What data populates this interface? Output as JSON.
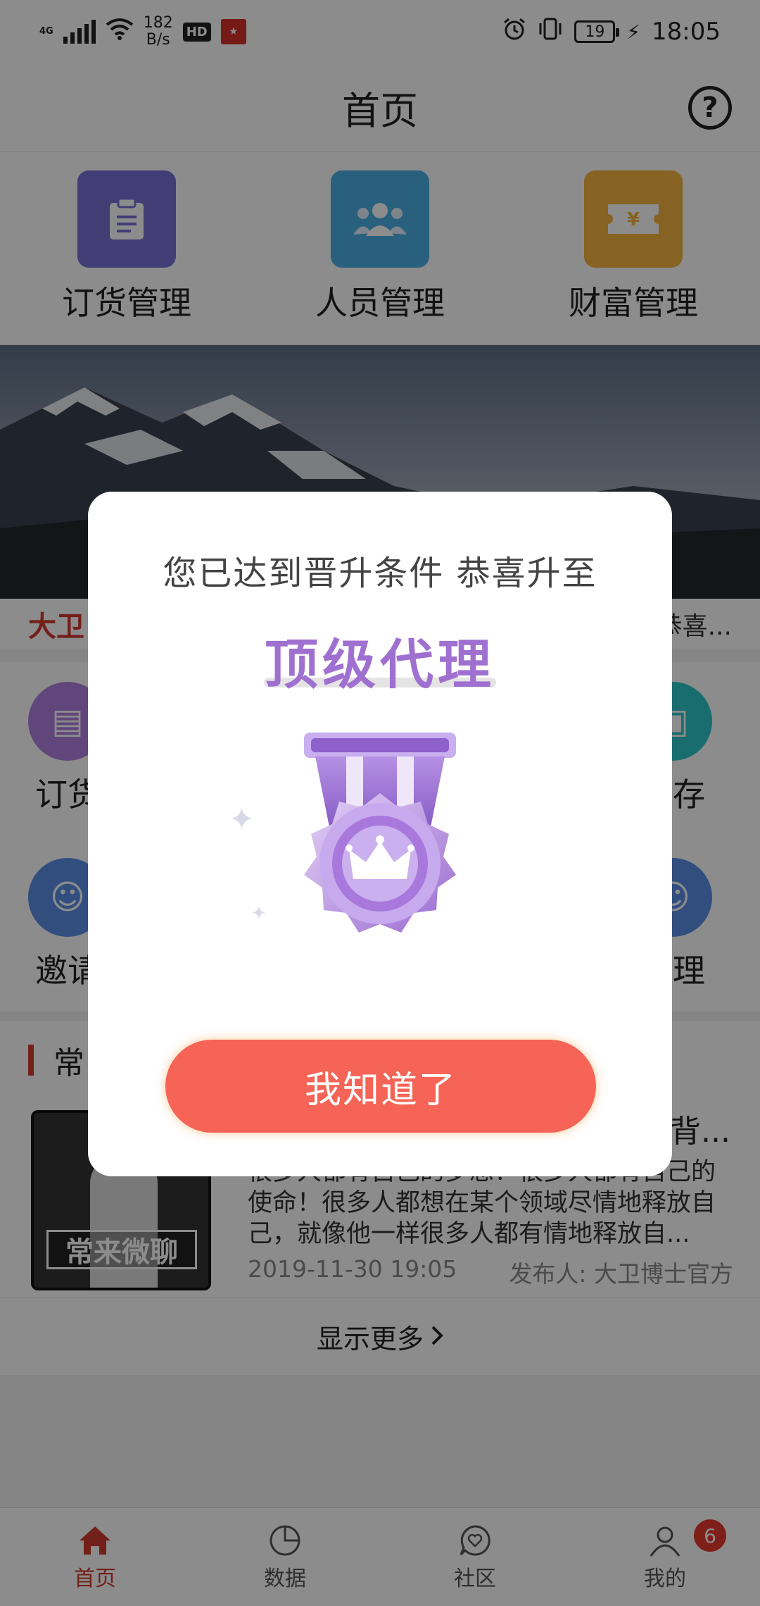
{
  "status_bar": {
    "network": "4G",
    "speed_value": "182",
    "speed_unit": "B/s",
    "hd": "HD",
    "battery": "19",
    "time": "18:05"
  },
  "header": {
    "title": "首页",
    "help": "?"
  },
  "quick_menu": [
    {
      "label": "订货管理",
      "icon": "clipboard-icon",
      "color": "#7b6fd8"
    },
    {
      "label": "人员管理",
      "icon": "people-icon",
      "color": "#4ab0e6"
    },
    {
      "label": "财富管理",
      "icon": "ticket-yen-icon",
      "color": "#f5b340"
    }
  ],
  "news": {
    "tag": "大卫",
    "tail": "恭喜..."
  },
  "grid_menu": [
    {
      "label": "订货",
      "color": "#b080e0"
    },
    {
      "label": "库存",
      "color": "#30c6c9"
    },
    {
      "label": "邀请",
      "color": "#5a8ee8"
    },
    {
      "label": "管理",
      "color": "#5a8ee8"
    }
  ],
  "section": {
    "title": "常",
    "article": {
      "thumb_text": "常来微聊",
      "title": "背...",
      "body": "很多人都有自己的梦想！很多人都有自己的使命！很多人都想在某个领域尽情地释放自己，就像他一样很多人都有情地释放自...",
      "date": "2019-11-30 19:05",
      "publisher": "发布人: 大卫博士官方"
    },
    "show_more": "显示更多"
  },
  "tabbar": [
    {
      "label": "首页",
      "active": true
    },
    {
      "label": "数据",
      "active": false
    },
    {
      "label": "社区",
      "active": false
    },
    {
      "label": "我的",
      "active": false,
      "badge": "6"
    }
  ],
  "dialog": {
    "message": "您已达到晋升条件 恭喜升至",
    "level": "顶级代理",
    "button": "我知道了",
    "accent_color": "#f56456",
    "level_color": "#a070d0"
  }
}
